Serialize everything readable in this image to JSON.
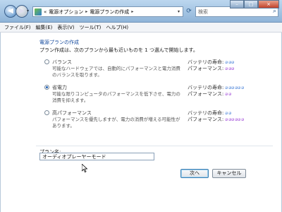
{
  "window": {
    "breadcrumb": [
      "電源オプション",
      "電源プランの作成"
    ],
    "breadcrumb_prefix": "«",
    "search_placeholder": "検索",
    "minimize": "–",
    "maximize": "□",
    "close": "×"
  },
  "menu": [
    "ファイル(F)",
    "編集(E)",
    "表示(V)",
    "ツール(T)",
    "ヘルプ(H)"
  ],
  "page": {
    "heading": "電源プランの作成",
    "instructions": "プラン作成は、次のプランから最も近いものを 1 つ選んで開始します。"
  },
  "plans": [
    {
      "title": "バランス",
      "description": "可能なハードウェアでは、自動的にパフォーマンスと電力消費のバランスを取ります。",
      "selected": false,
      "battery_label": "バッテリの寿命:",
      "battery_level": 3,
      "performance_label": "パフォーマンス:",
      "performance_level": 3
    },
    {
      "title": "省電力",
      "description": "可能な限りコンピュータのパフォーマンスを低下させ、電力の消費を抑えます。",
      "selected": true,
      "battery_label": "バッテリの寿命:",
      "battery_level": 6,
      "performance_label": "パフォーマンス:",
      "performance_level": 2
    },
    {
      "title": "高パフォーマンス",
      "description": "パフォーマンスを優先しますが、電力の消費が増える可能性があります。",
      "selected": false,
      "battery_label": "バッテリの寿命:",
      "battery_level": 2,
      "performance_label": "パフォーマンス:",
      "performance_level": 6
    }
  ],
  "plan_name": {
    "label": "プラン名:",
    "value": "オーディオプレーヤーモード"
  },
  "buttons": {
    "next": "次へ",
    "cancel": "キャンセル"
  },
  "colors": {
    "battery_dot": "#3c7ad6",
    "performance_dot": "#9b3fd6",
    "heading": "#1b4fa0"
  }
}
